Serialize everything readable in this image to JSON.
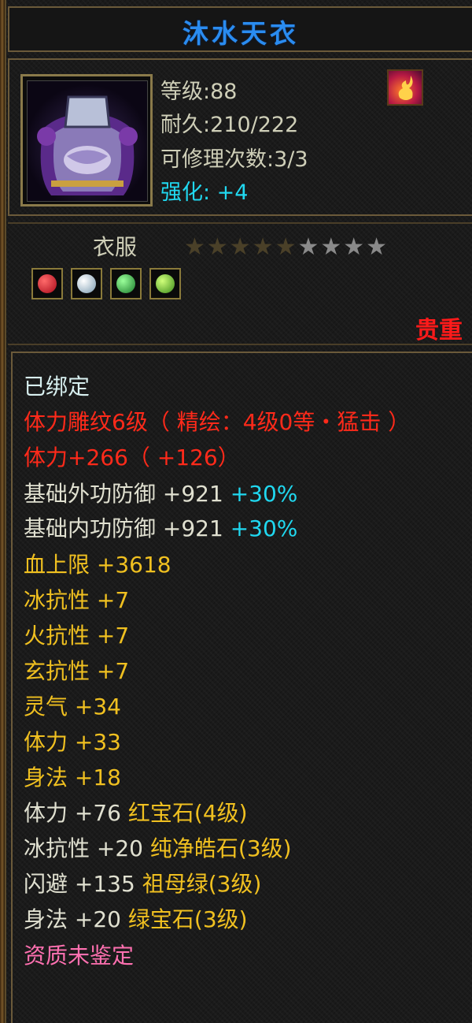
{
  "item": {
    "name": "沐水天衣",
    "level_label": "等级:88",
    "durability_label": "耐久:210/222",
    "repair_label": "可修理次数:3/3",
    "enhance_label": "强化: +4",
    "category": "衣服",
    "stars": {
      "dim": "★★★★★",
      "lit": "★★★★",
      "count": 9
    },
    "rarity": "贵重",
    "gems": [
      "red-gem-icon",
      "white-gem-icon",
      "green-gem-icon",
      "light-green-gem-icon"
    ]
  },
  "description": {
    "bound": "已绑定",
    "engrave": "体力雕纹6级（ 精绘：4级0等・猛击 ）",
    "vitality_bonus": "体力+266（ +126）",
    "ext_def_label": "基础外功防御 +921",
    "ext_def_pct": "+30%",
    "int_def_label": "基础内功防御 +921",
    "int_def_pct": "+30%",
    "attrs": [
      "血上限 +3618",
      "冰抗性 +7",
      "火抗性 +7",
      "玄抗性 +7",
      "灵气 +34",
      "体力 +33",
      "身法 +18"
    ],
    "gem_attrs": [
      {
        "stat": "体力 +76",
        "gem": "红宝石(4级)"
      },
      {
        "stat": "冰抗性 +20",
        "gem": "纯净皓石(3级)"
      },
      {
        "stat": "闪避 +135",
        "gem": "祖母绿(3级)"
      },
      {
        "stat": "身法 +20",
        "gem": "绿宝石(3级)"
      }
    ],
    "quality": "资质未鉴定"
  }
}
